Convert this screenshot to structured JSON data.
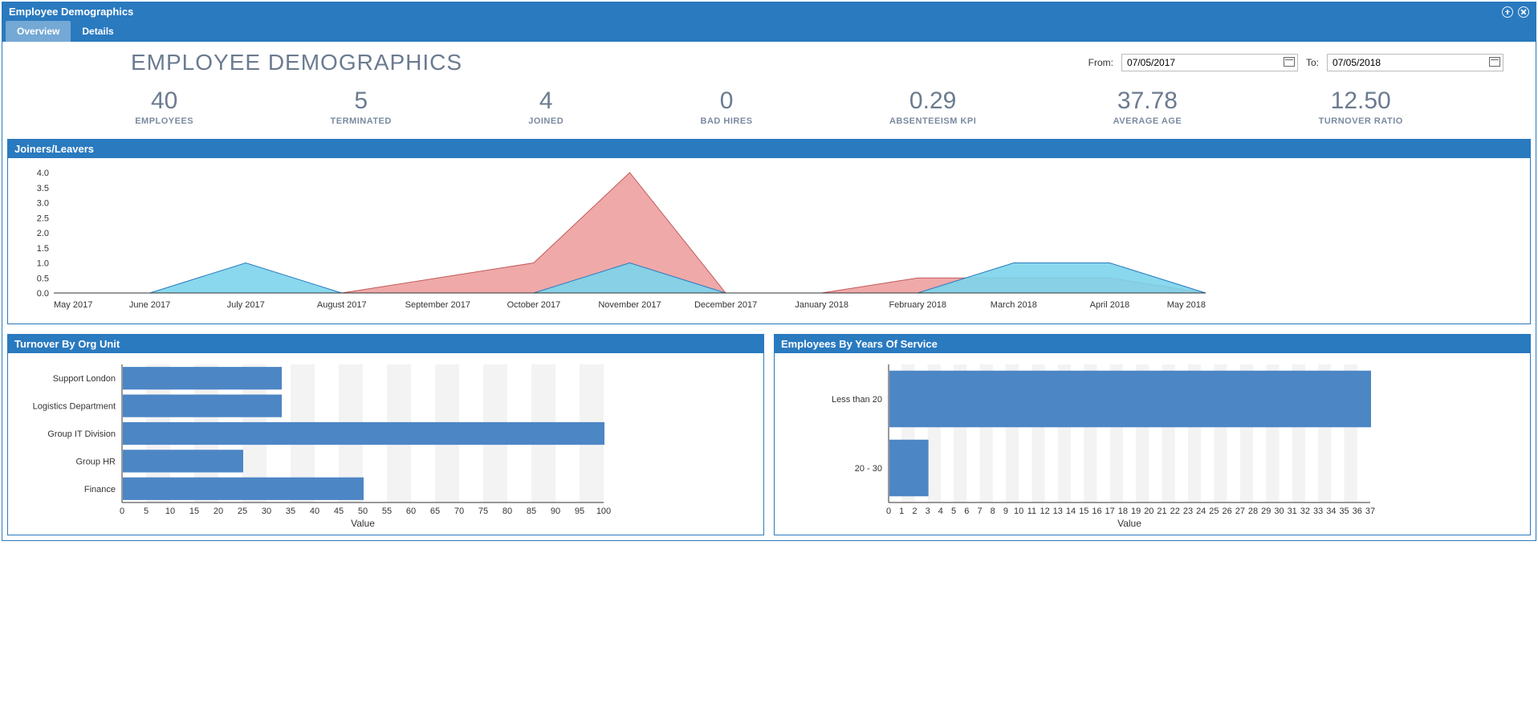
{
  "window": {
    "title": "Employee Demographics"
  },
  "tabs": [
    {
      "label": "Overview",
      "active": true
    },
    {
      "label": "Details",
      "active": false
    }
  ],
  "page_title": "EMPLOYEE DEMOGRAPHICS",
  "date_range": {
    "from_label": "From:",
    "from_value": "07/05/2017",
    "to_label": "To:",
    "to_value": "07/05/2018"
  },
  "metrics": [
    {
      "value": "40",
      "label": "EMPLOYEES"
    },
    {
      "value": "5",
      "label": "TERMINATED"
    },
    {
      "value": "4",
      "label": "JOINED"
    },
    {
      "value": "0",
      "label": "BAD HIRES"
    },
    {
      "value": "0.29",
      "label": "ABSENTEEISM KPI"
    },
    {
      "value": "37.78",
      "label": "AVERAGE AGE"
    },
    {
      "value": "12.50",
      "label": "TURNOVER RATIO"
    }
  ],
  "panels": {
    "joiners": "Joiners/Leavers",
    "turnover": "Turnover By Org Unit",
    "years": "Employees By Years Of Service"
  },
  "chart_data": [
    {
      "type": "area",
      "title": "Joiners/Leavers",
      "categories": [
        "May 2017",
        "June 2017",
        "July 2017",
        "August 2017",
        "September 2017",
        "October 2017",
        "November 2017",
        "December 2017",
        "January 2018",
        "February 2018",
        "March 2018",
        "April 2018",
        "May 2018"
      ],
      "series": [
        {
          "name": "Leavers",
          "color": "#e98c8c",
          "values": [
            0,
            0,
            0,
            0,
            0.5,
            1,
            4,
            0,
            0,
            0.5,
            0.5,
            0.5,
            0
          ]
        },
        {
          "name": "Joiners",
          "color": "#7cd4eb",
          "values": [
            0,
            0,
            1,
            0,
            0,
            0,
            1,
            0,
            0,
            0,
            1,
            1,
            0
          ]
        }
      ],
      "yticks": [
        0.0,
        0.5,
        1.0,
        1.5,
        2.0,
        2.5,
        3.0,
        3.5,
        4.0
      ],
      "ylim": [
        0,
        4
      ]
    },
    {
      "type": "bar",
      "orientation": "horizontal",
      "title": "Turnover By Org Unit",
      "xlabel": "Value",
      "categories": [
        "Support London",
        "Logistics Department",
        "Group IT Division",
        "Group HR",
        "Finance"
      ],
      "values": [
        33,
        33,
        100,
        25,
        50
      ],
      "xlim": [
        0,
        100
      ],
      "xticks": [
        0,
        5,
        10,
        15,
        20,
        25,
        30,
        35,
        40,
        45,
        50,
        55,
        60,
        65,
        70,
        75,
        80,
        85,
        90,
        95,
        100
      ]
    },
    {
      "type": "bar",
      "orientation": "horizontal",
      "title": "Employees By Years Of Service",
      "xlabel": "Value",
      "categories": [
        "Less than 20",
        "20 - 30"
      ],
      "values": [
        37,
        3
      ],
      "xlim": [
        0,
        37
      ],
      "xticks": [
        0,
        1,
        2,
        3,
        4,
        5,
        6,
        7,
        8,
        9,
        10,
        11,
        12,
        13,
        14,
        15,
        16,
        17,
        18,
        19,
        20,
        21,
        22,
        23,
        24,
        25,
        26,
        27,
        28,
        29,
        30,
        31,
        32,
        33,
        34,
        35,
        36,
        37
      ]
    }
  ]
}
